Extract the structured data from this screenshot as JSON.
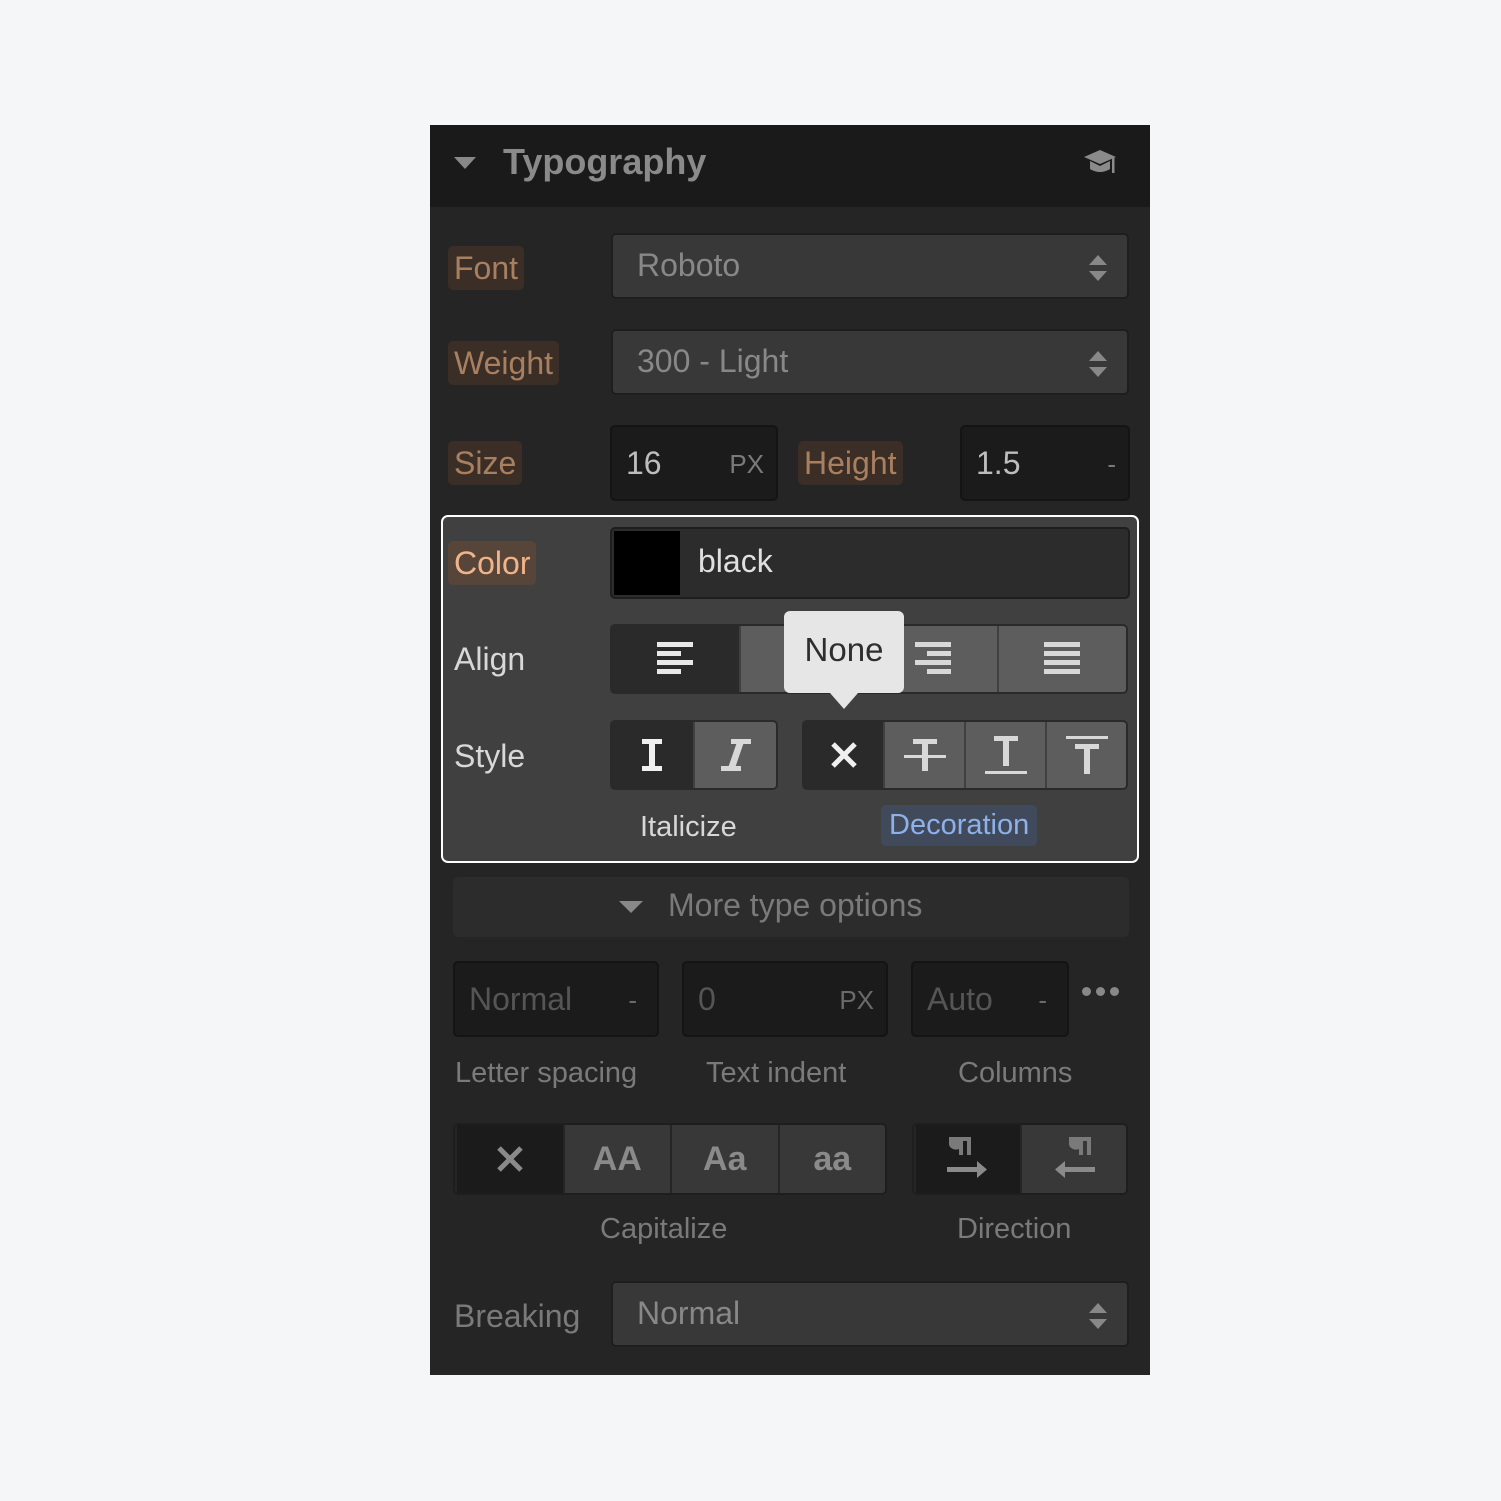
{
  "header": {
    "title": "Typography",
    "collapse_icon": "caret-down-icon",
    "help_icon": "graduation-cap-icon"
  },
  "font": {
    "label": "Font",
    "value": "Roboto"
  },
  "weight": {
    "label": "Weight",
    "value": "300 - Light"
  },
  "size": {
    "label": "Size",
    "value": "16",
    "unit": "PX"
  },
  "height": {
    "label": "Height",
    "value": "1.5",
    "unit": "-"
  },
  "color": {
    "label": "Color",
    "value": "black",
    "swatch": "#000000"
  },
  "align": {
    "label": "Align",
    "options": [
      "left",
      "center",
      "right",
      "justify"
    ],
    "selected": "left"
  },
  "style": {
    "label": "Style",
    "italicize": {
      "caption": "Italicize",
      "options": [
        "regular",
        "italic"
      ],
      "selected": "regular"
    },
    "decoration": {
      "caption": "Decoration",
      "options": [
        "none",
        "strikethrough",
        "underline",
        "overline"
      ],
      "selected": "none"
    }
  },
  "tooltip": {
    "text": "None"
  },
  "more": {
    "label": "More type options"
  },
  "letter_spacing": {
    "caption": "Letter spacing",
    "value": "Normal",
    "unit": "-"
  },
  "text_indent": {
    "caption": "Text indent",
    "value": "0",
    "unit": "PX"
  },
  "columns": {
    "caption": "Columns",
    "value": "Auto",
    "unit": "-"
  },
  "capitalize": {
    "caption": "Capitalize",
    "options": [
      "none",
      "AA",
      "Aa",
      "aa"
    ],
    "selected": "none"
  },
  "direction": {
    "caption": "Direction",
    "options": [
      "ltr",
      "rtl"
    ],
    "selected": "ltr"
  },
  "breaking": {
    "label": "Breaking",
    "value": "Normal"
  },
  "colors": {
    "panel_bg": "#252525",
    "header_bg": "#1a1a1a",
    "label_tag": "#a9805f",
    "label_tag_active": "#f0b48a",
    "focus_blue": "#8fb1ea"
  }
}
